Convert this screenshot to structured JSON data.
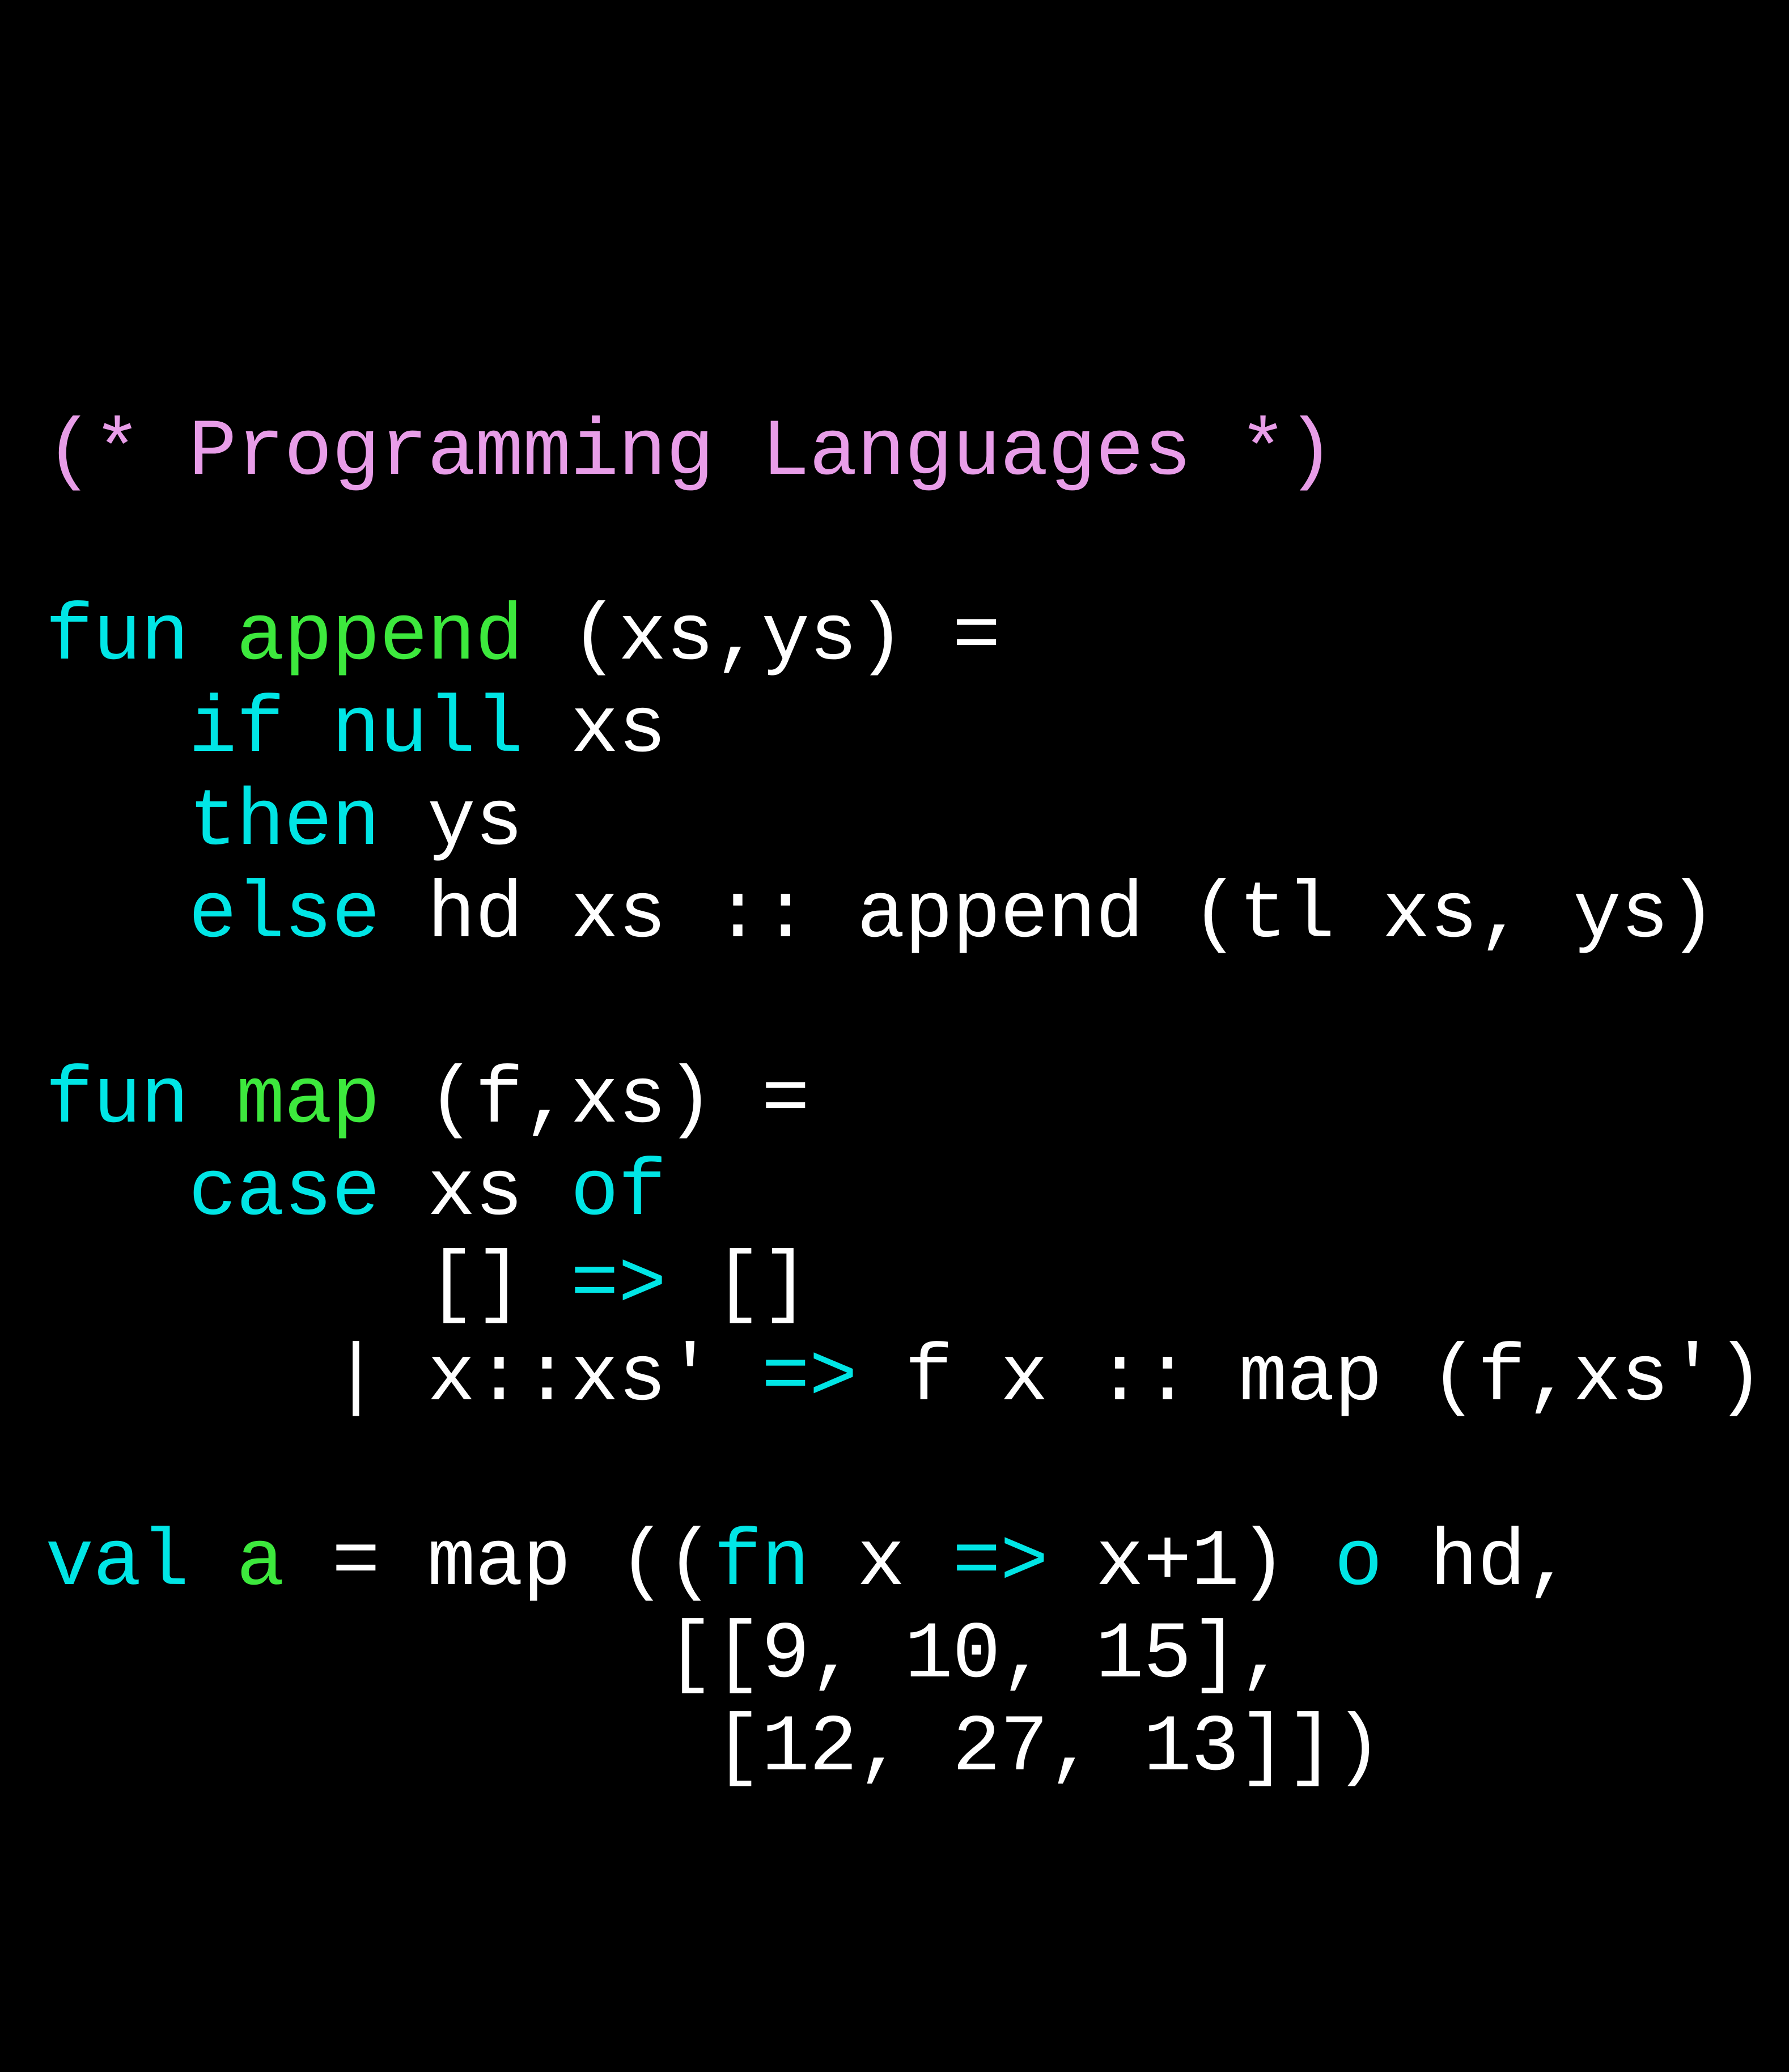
{
  "code": {
    "line1": {
      "comment": "(* Programming Languages *)"
    },
    "line3": {
      "kw_fun": "fun",
      "id_append": "append",
      "rest": " (xs,ys) ="
    },
    "line4": {
      "indent": "   ",
      "kw_if": "if",
      "sp": " ",
      "kw_null": "null",
      "rest": " xs"
    },
    "line5": {
      "indent": "   ",
      "kw_then": "then",
      "rest": " ys"
    },
    "line6": {
      "indent": "   ",
      "kw_else": "else",
      "rest": " hd xs :: append (tl xs, ys)"
    },
    "line8": {
      "kw_fun": "fun",
      "id_map": "map",
      "rest": " (f,xs) ="
    },
    "line9": {
      "indent": "   ",
      "kw_case": "case",
      "sp": " xs ",
      "kw_of": "of"
    },
    "line10": {
      "indent": "        ",
      "l1": "[] ",
      "arrow": "=>",
      "l2": " []"
    },
    "line11": {
      "indent": "      ",
      "l1": "| x::xs' ",
      "arrow": "=>",
      "l2": " f x :: map (f,xs')"
    },
    "line13": {
      "kw_val": "val",
      "sp": " ",
      "id_a": "a",
      "eq": " = map ((",
      "kw_fn": "fn",
      "mid": " x ",
      "arrow": "=>",
      "after": " x+1) ",
      "kw_o": "o",
      "tail": " hd,"
    },
    "line14": {
      "content": "             [[9, 10, 15],"
    },
    "line15": {
      "content": "              [12, 27, 13]])"
    }
  }
}
